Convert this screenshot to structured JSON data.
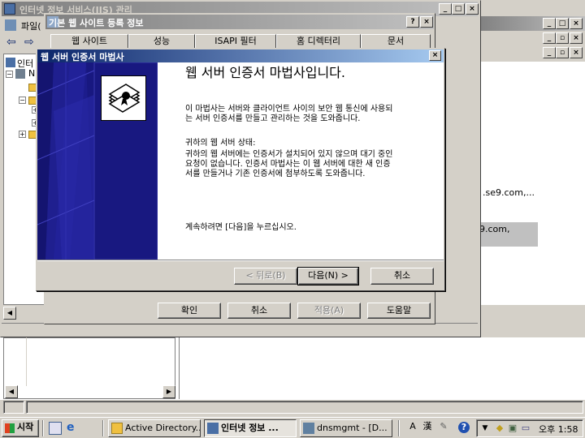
{
  "iis_window": {
    "title": "인터넷 정보 서비스(IIS) 관리",
    "menu_file": "파일(",
    "tree_root": "인터",
    "tree_node": "N"
  },
  "props_dialog": {
    "title": "기본 웹 사이트 등록 정보",
    "tabs": [
      "웹 사이트",
      "성능",
      "ISAPI 필터",
      "홈 디렉터리",
      "문서"
    ],
    "ok": "확인",
    "cancel": "취소",
    "apply": "적용(A)",
    "help": "도움말",
    "help_btn": "?",
    "close_btn": "×"
  },
  "bg_right": {
    "text1": ".se9.com,...",
    "text2": "9.com,"
  },
  "wizard": {
    "title": "웹 서버 인증서 마법사",
    "heading": "웹 서버 인증서 마법사입니다.",
    "intro": "이 마법사는 서버와 클라이언트 사이의 보안 웹 통신에 사용되는 서버 인증서를 만들고 관리하는 것을 도와줍니다.",
    "status_label": "귀하의 웹 서버 상태:",
    "status_text": "귀하의 웹 서버에는 인증서가 설치되어 있지 않으며 대기 중인 요청이 없습니다. 인증서 마법사는 이 웹 서버에 대한 새 인증서를 만들거나 기존 인증서에 첨부하도록 도와줍니다.",
    "continue_text": "계속하려면 [다음]을 누르십시오.",
    "back": "< 뒤로(B)",
    "next": "다음(N) >",
    "cancel": "취소",
    "close_btn": "×"
  },
  "taskbar": {
    "start": "시작",
    "tasks": [
      {
        "label": "Active Directory..."
      },
      {
        "label": "인터넷 정보 ..."
      },
      {
        "label": "dnsmgmt - [D..."
      }
    ],
    "ime": [
      "A",
      "漢"
    ],
    "clock": "오후 1:58"
  },
  "colors": {
    "face": "#d4d0c8",
    "active_title": "#0a246a",
    "inactive_title": "#808080",
    "wizard_banner": "#1c1c8c",
    "desktop_highlight": "#c0c0c0"
  }
}
